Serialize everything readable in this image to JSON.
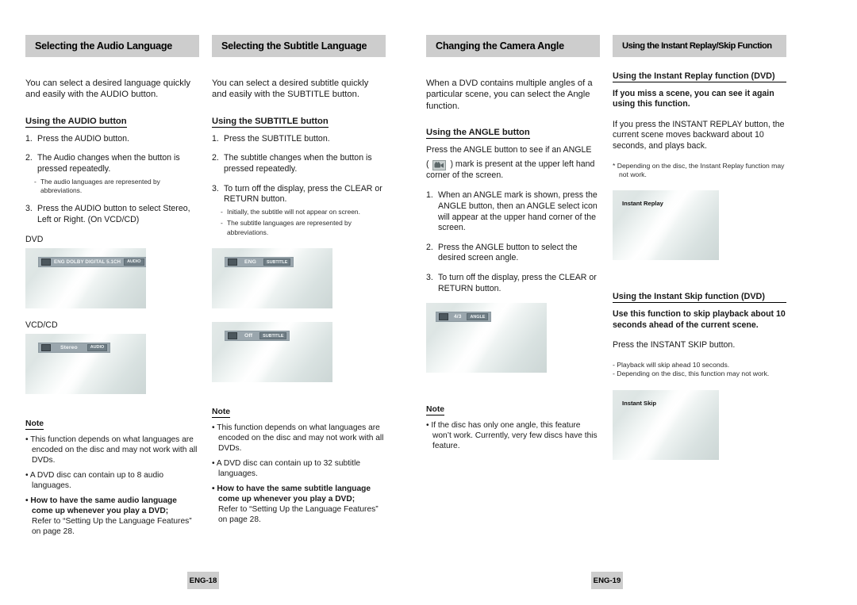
{
  "document": {
    "type": "dvd-player-manual-spread",
    "language_code": "ENG"
  },
  "columns": [
    {
      "id": "audio-language",
      "header": "Selecting the Audio Language",
      "intro": "You can select a desired language quickly and easily with the AUDIO button.",
      "subheading": "Using the AUDIO button",
      "steps": [
        {
          "num": "1.",
          "text": "Press the AUDIO button."
        },
        {
          "num": "2.",
          "text": "The Audio changes when the button is pressed repeatedly.",
          "subnote": "The audio languages are represented by abbreviations."
        },
        {
          "num": "3.",
          "text": "Press the AUDIO button to select Stereo, Left or Right. (On VCD/CD)"
        }
      ],
      "screens": [
        {
          "label": "DVD",
          "osd_text": "ENG DOLBY DIGITAL 5.1CH",
          "osd_badge": "AUDIO",
          "icon": "audio-speaker-icon"
        },
        {
          "label": "VCD/CD",
          "osd_text": "Stereo",
          "osd_badge": "AUDIO",
          "icon": "audio-speaker-icon"
        }
      ],
      "note_heading": "Note",
      "notes": [
        {
          "text": "This function depends on what languages are encoded on the disc and may not work with all DVDs.",
          "bold": false
        },
        {
          "text": "A DVD disc can contain up to 8 audio languages.",
          "bold": false
        },
        {
          "text": "How to have the same audio language come up whenever you play a DVD;",
          "bold": true,
          "sub": "Refer to “Setting Up the Language Features” on page 28."
        }
      ]
    },
    {
      "id": "subtitle-language",
      "header": "Selecting the Subtitle Language",
      "intro": "You can select a desired subtitle quickly and easily with the SUBTITLE button.",
      "subheading": "Using the SUBTITLE button",
      "steps": [
        {
          "num": "1.",
          "text": "Press the SUBTITLE button."
        },
        {
          "num": "2.",
          "text": "The subtitle changes when the button is pressed repeatedly."
        },
        {
          "num": "3.",
          "text": "To turn off the display, press the CLEAR or RETURN button.",
          "subnote": "Initially, the subtitle will not appear on screen.",
          "subnote2": "The subtitle languages are represented by abbreviations."
        }
      ],
      "screens": [
        {
          "label": "",
          "osd_text": "ENG",
          "osd_badge": "SUBTITLE",
          "icon": "subtitle-icon"
        },
        {
          "label": "",
          "osd_text": "Off",
          "osd_badge": "SUBTITLE",
          "icon": "subtitle-icon"
        }
      ],
      "note_heading": "Note",
      "notes": [
        {
          "text": "This function depends on what languages are encoded on the disc and may not work with all DVDs.",
          "bold": false
        },
        {
          "text": "A DVD disc can contain up to 32 subtitle languages.",
          "bold": false
        },
        {
          "text": "How to have the same subtitle language come up whenever you play a DVD;",
          "bold": true,
          "sub": "Refer to “Setting Up the Language Features” on page 28."
        }
      ]
    },
    {
      "id": "camera-angle",
      "header": "Changing the Camera Angle",
      "intro": "When a DVD contains multiple angles of a particular scene, you can select the Angle function.",
      "subheading": "Using the ANGLE button",
      "angle_line_a": "Press the ANGLE button to see if an ANGLE",
      "angle_line_b_pre": "(",
      "angle_line_b_post": ") mark is present at the upper left hand corner of the screen.",
      "angle_mark_icon": "angle-camera-icon",
      "steps": [
        {
          "num": "1.",
          "text": "When an ANGLE mark is shown, press the ANGLE button, then an ANGLE select icon will appear at the upper hand corner of the screen."
        },
        {
          "num": "2.",
          "text": "Press the ANGLE button to select the desired screen angle."
        },
        {
          "num": "3.",
          "text": "To turn off the display, press the CLEAR or RETURN button."
        }
      ],
      "screens": [
        {
          "label": "",
          "osd_text": "4/3",
          "osd_badge": "ANGLE",
          "icon": "angle-camera-icon"
        }
      ],
      "note_heading": "Note",
      "notes": [
        {
          "text": "If the disc has only one angle, this feature won’t work. Currently, very few discs have this feature.",
          "bold": false
        }
      ]
    },
    {
      "id": "instant-replay-skip",
      "header": "Using the Instant Replay/Skip Function",
      "replay": {
        "subheading": "Using the Instant Replay function (DVD)",
        "bold_lead": "If you miss a scene, you can see it again using this function.",
        "para": "If you press the INSTANT REPLAY button, the current scene moves backward about 10 seconds, and plays back.",
        "star_note": "* Depending on the disc, the Instant Replay function may not work.",
        "screen_caption": "Instant Replay"
      },
      "skip": {
        "subheading": "Using the Instant Skip function (DVD)",
        "bold_lead": "Use this function to skip playback about 10 seconds ahead of the current scene.",
        "para": "Press the INSTANT SKIP button.",
        "dash_notes": [
          "Playback will skip ahead 10 seconds.",
          "Depending on the disc, this function may not work."
        ],
        "screen_caption": "Instant Skip"
      }
    }
  ],
  "footers": {
    "left": "ENG-18",
    "right": "ENG-19"
  },
  "colors": {
    "header_bar": "#cdcdcd",
    "footer_bar": "#cdcdcd",
    "text": "#1a1a1a",
    "osd_bar": "#9aa6ad"
  }
}
